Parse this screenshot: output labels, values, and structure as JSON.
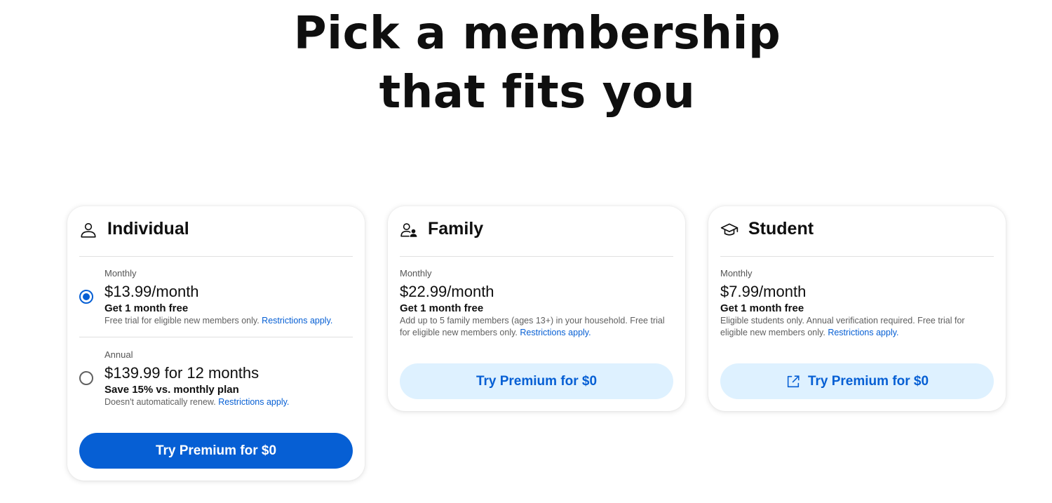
{
  "headline": {
    "line1": "Pick a membership",
    "line2": "that fits you"
  },
  "cards": {
    "individual": {
      "title": "Individual",
      "icon": "person-icon",
      "plans": [
        {
          "period": "Monthly",
          "price": "$13.99/month",
          "offer": "Get 1 month free",
          "fine": "Free trial for eligible new members only.",
          "link": "Restrictions apply.",
          "selected": true
        },
        {
          "period": "Annual",
          "price": "$139.99 for 12 months",
          "offer": "Save 15% vs. monthly plan",
          "fine": "Doesn't automatically renew.",
          "link": "Restrictions apply.",
          "selected": false
        }
      ],
      "cta": "Try Premium for $0"
    },
    "family": {
      "title": "Family",
      "icon": "family-icon",
      "plan": {
        "period": "Monthly",
        "price": "$22.99/month",
        "offer": "Get 1 month free",
        "fine": "Add up to 5 family members (ages 13+) in your household. Free trial for eligible new members only.",
        "link": "Restrictions apply."
      },
      "cta": "Try Premium for $0"
    },
    "student": {
      "title": "Student",
      "icon": "graduation-cap-icon",
      "plan": {
        "period": "Monthly",
        "price": "$7.99/month",
        "offer": "Get 1 month free",
        "fine": "Eligible students only. Annual verification required. Free trial for eligible new members only.",
        "link": "Restrictions apply."
      },
      "cta": "Try Premium for $0",
      "cta_icon": "external-link-icon"
    }
  },
  "colors": {
    "accent": "#065fd4",
    "secondary_button_bg": "#def1ff",
    "text": "#0f0f0f",
    "muted_text": "#606060"
  }
}
